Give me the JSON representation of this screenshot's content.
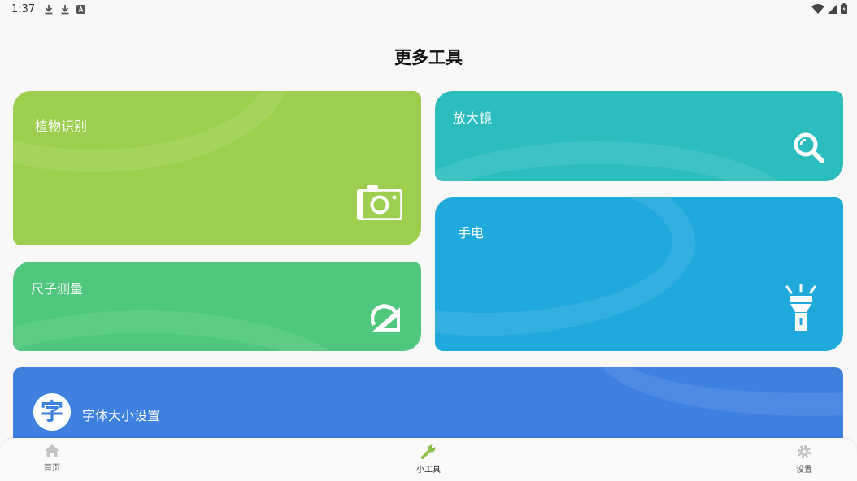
{
  "status_bar": {
    "time": "1:37",
    "left_icons": [
      "download-icon",
      "download-icon",
      "app-notification-icon"
    ],
    "right_icons": [
      "wifi-icon",
      "signal-icon",
      "battery-icon"
    ]
  },
  "page": {
    "title": "更多工具"
  },
  "cards": {
    "plant": {
      "label": "植物识别",
      "icon": "camera-icon",
      "color": "#9dcf4e"
    },
    "ruler": {
      "label": "尺子测量",
      "icon": "ruler-icon",
      "color": "#4fc77c"
    },
    "magnifier": {
      "label": "放大镜",
      "icon": "magnifier-icon",
      "color": "#2bbcbe"
    },
    "torch": {
      "label": "手电",
      "icon": "flashlight-icon",
      "color": "#1fa9dc"
    },
    "font": {
      "label": "字体大小设置",
      "badge": "字",
      "color": "#3d80e0"
    }
  },
  "bottom_nav": {
    "items": [
      {
        "label": "首页",
        "icon": "home-icon",
        "active": false
      },
      {
        "label": "小工具",
        "icon": "wrench-icon",
        "active": true,
        "active_color": "#8bc34a"
      },
      {
        "label": "设置",
        "icon": "gear-icon",
        "active": false
      }
    ]
  }
}
